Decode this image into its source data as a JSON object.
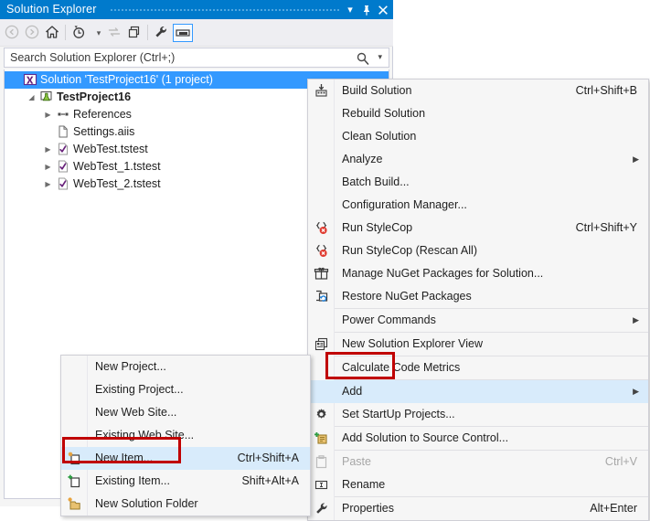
{
  "window": {
    "title": "Solution Explorer",
    "buttons": {
      "menu": "▾",
      "pin": "⊥",
      "close": "✕"
    }
  },
  "toolbar": {
    "items": [
      {
        "name": "back",
        "glyph": "⬅",
        "enabled": false
      },
      {
        "name": "forward",
        "glyph": "➡",
        "enabled": false
      },
      {
        "name": "home",
        "glyph": "home",
        "enabled": true
      },
      {
        "name": "pending-changes",
        "glyph": "clock",
        "enabled": true
      },
      {
        "name": "pending-changes-dropdown",
        "glyph": "▾",
        "enabled": true
      },
      {
        "name": "sync-with-active-document",
        "glyph": "⇆",
        "enabled": false
      },
      {
        "name": "show-all-files",
        "glyph": "copy",
        "enabled": true
      },
      {
        "name": "properties",
        "glyph": "wrench",
        "enabled": true
      },
      {
        "name": "preview-selected-items",
        "glyph": "preview",
        "enabled": true
      }
    ]
  },
  "search": {
    "placeholder": "Search Solution Explorer (Ctrl+;)",
    "icon": "search-icon",
    "dropdown": "▾"
  },
  "tree": {
    "items": [
      {
        "label": "Solution 'TestProject16' (1 project)",
        "icon": "solution-icon",
        "indent": 0,
        "expander": "",
        "selected": true,
        "bold": false
      },
      {
        "label": "TestProject16",
        "icon": "project-icon",
        "indent": 1,
        "expander": "▼",
        "selected": false,
        "bold": true
      },
      {
        "label": "References",
        "icon": "references-icon",
        "indent": 2,
        "expander": "▶",
        "selected": false,
        "bold": false
      },
      {
        "label": "Settings.aiis",
        "icon": "file-icon",
        "indent": 2,
        "expander": "",
        "selected": false,
        "bold": false
      },
      {
        "label": "WebTest.tstest",
        "icon": "test-icon",
        "indent": 2,
        "expander": "▶",
        "selected": false,
        "bold": false
      },
      {
        "label": "WebTest_1.tstest",
        "icon": "test-icon",
        "indent": 2,
        "expander": "▶",
        "selected": false,
        "bold": false
      },
      {
        "label": "WebTest_2.tstest",
        "icon": "test-icon",
        "indent": 2,
        "expander": "▶",
        "selected": false,
        "bold": false
      }
    ]
  },
  "context_menu": {
    "items": [
      {
        "type": "item",
        "label": "Build Solution",
        "shortcut": "Ctrl+Shift+B",
        "icon": "build-icon",
        "submenu": false,
        "highlighted": false,
        "disabled": false
      },
      {
        "type": "item",
        "label": "Rebuild Solution",
        "shortcut": "",
        "icon": "",
        "submenu": false,
        "highlighted": false,
        "disabled": false
      },
      {
        "type": "item",
        "label": "Clean Solution",
        "shortcut": "",
        "icon": "",
        "submenu": false,
        "highlighted": false,
        "disabled": false
      },
      {
        "type": "item",
        "label": "Analyze",
        "shortcut": "",
        "icon": "",
        "submenu": true,
        "highlighted": false,
        "disabled": false
      },
      {
        "type": "item",
        "label": "Batch Build...",
        "shortcut": "",
        "icon": "",
        "submenu": false,
        "highlighted": false,
        "disabled": false
      },
      {
        "type": "item",
        "label": "Configuration Manager...",
        "shortcut": "",
        "icon": "",
        "submenu": false,
        "highlighted": false,
        "disabled": false
      },
      {
        "type": "item",
        "label": "Run StyleCop",
        "shortcut": "Ctrl+Shift+Y",
        "icon": "stylecop-icon",
        "submenu": false,
        "highlighted": false,
        "disabled": false
      },
      {
        "type": "item",
        "label": "Run StyleCop (Rescan All)",
        "shortcut": "",
        "icon": "stylecop-icon",
        "submenu": false,
        "highlighted": false,
        "disabled": false
      },
      {
        "type": "item",
        "label": "Manage NuGet Packages for Solution...",
        "shortcut": "",
        "icon": "nuget-icon",
        "submenu": false,
        "highlighted": false,
        "disabled": false
      },
      {
        "type": "item",
        "label": "Restore NuGet Packages",
        "shortcut": "",
        "icon": "restore-nuget-icon",
        "submenu": false,
        "highlighted": false,
        "disabled": false
      },
      {
        "type": "separator"
      },
      {
        "type": "item",
        "label": "Power Commands",
        "shortcut": "",
        "icon": "",
        "submenu": true,
        "highlighted": false,
        "disabled": false
      },
      {
        "type": "separator"
      },
      {
        "type": "item",
        "label": "New Solution Explorer View",
        "shortcut": "",
        "icon": "new-view-icon",
        "submenu": false,
        "highlighted": false,
        "disabled": false
      },
      {
        "type": "separator"
      },
      {
        "type": "item",
        "label": "Calculate Code Metrics",
        "shortcut": "",
        "icon": "",
        "submenu": false,
        "highlighted": false,
        "disabled": false
      },
      {
        "type": "separator"
      },
      {
        "type": "item",
        "label": "Add",
        "shortcut": "",
        "icon": "",
        "submenu": true,
        "highlighted": true,
        "disabled": false
      },
      {
        "type": "item",
        "label": "Set StartUp Projects...",
        "shortcut": "",
        "icon": "gear-icon",
        "submenu": false,
        "highlighted": false,
        "disabled": false
      },
      {
        "type": "separator"
      },
      {
        "type": "item",
        "label": "Add Solution to Source Control...",
        "shortcut": "",
        "icon": "source-control-icon",
        "submenu": false,
        "highlighted": false,
        "disabled": false
      },
      {
        "type": "separator"
      },
      {
        "type": "item",
        "label": "Paste",
        "shortcut": "Ctrl+V",
        "icon": "paste-icon",
        "submenu": false,
        "highlighted": false,
        "disabled": true
      },
      {
        "type": "item",
        "label": "Rename",
        "shortcut": "",
        "icon": "rename-icon",
        "submenu": false,
        "highlighted": false,
        "disabled": false
      },
      {
        "type": "separator"
      },
      {
        "type": "item",
        "label": "Properties",
        "shortcut": "Alt+Enter",
        "icon": "properties-icon",
        "submenu": false,
        "highlighted": false,
        "disabled": false
      }
    ]
  },
  "add_submenu": {
    "items": [
      {
        "type": "item",
        "label": "New Project...",
        "shortcut": "",
        "icon": "",
        "highlighted": false
      },
      {
        "type": "item",
        "label": "Existing Project...",
        "shortcut": "",
        "icon": "",
        "highlighted": false
      },
      {
        "type": "item",
        "label": "New Web Site...",
        "shortcut": "",
        "icon": "",
        "highlighted": false
      },
      {
        "type": "item",
        "label": "Existing Web Site...",
        "shortcut": "",
        "icon": "",
        "highlighted": false
      },
      {
        "type": "item",
        "label": "New Item...",
        "shortcut": "Ctrl+Shift+A",
        "icon": "new-item-icon",
        "highlighted": true
      },
      {
        "type": "item",
        "label": "Existing Item...",
        "shortcut": "Shift+Alt+A",
        "icon": "existing-item-icon",
        "highlighted": false
      },
      {
        "type": "item",
        "label": "New Solution Folder",
        "shortcut": "",
        "icon": "new-folder-icon",
        "highlighted": false
      }
    ]
  },
  "annotations": [
    {
      "name": "add-highlight-box",
      "color": "#c00000",
      "target": "Add"
    },
    {
      "name": "new-item-highlight-box",
      "color": "#c00000",
      "target": "New Item..."
    }
  ],
  "colors": {
    "title_bar": "#007acc",
    "selection": "#3399ff",
    "menu_highlight": "#d8ebfb",
    "annotation": "#c00000",
    "panel_bg": "#f5f5f5",
    "toolbar_bg": "#eeeef2"
  }
}
